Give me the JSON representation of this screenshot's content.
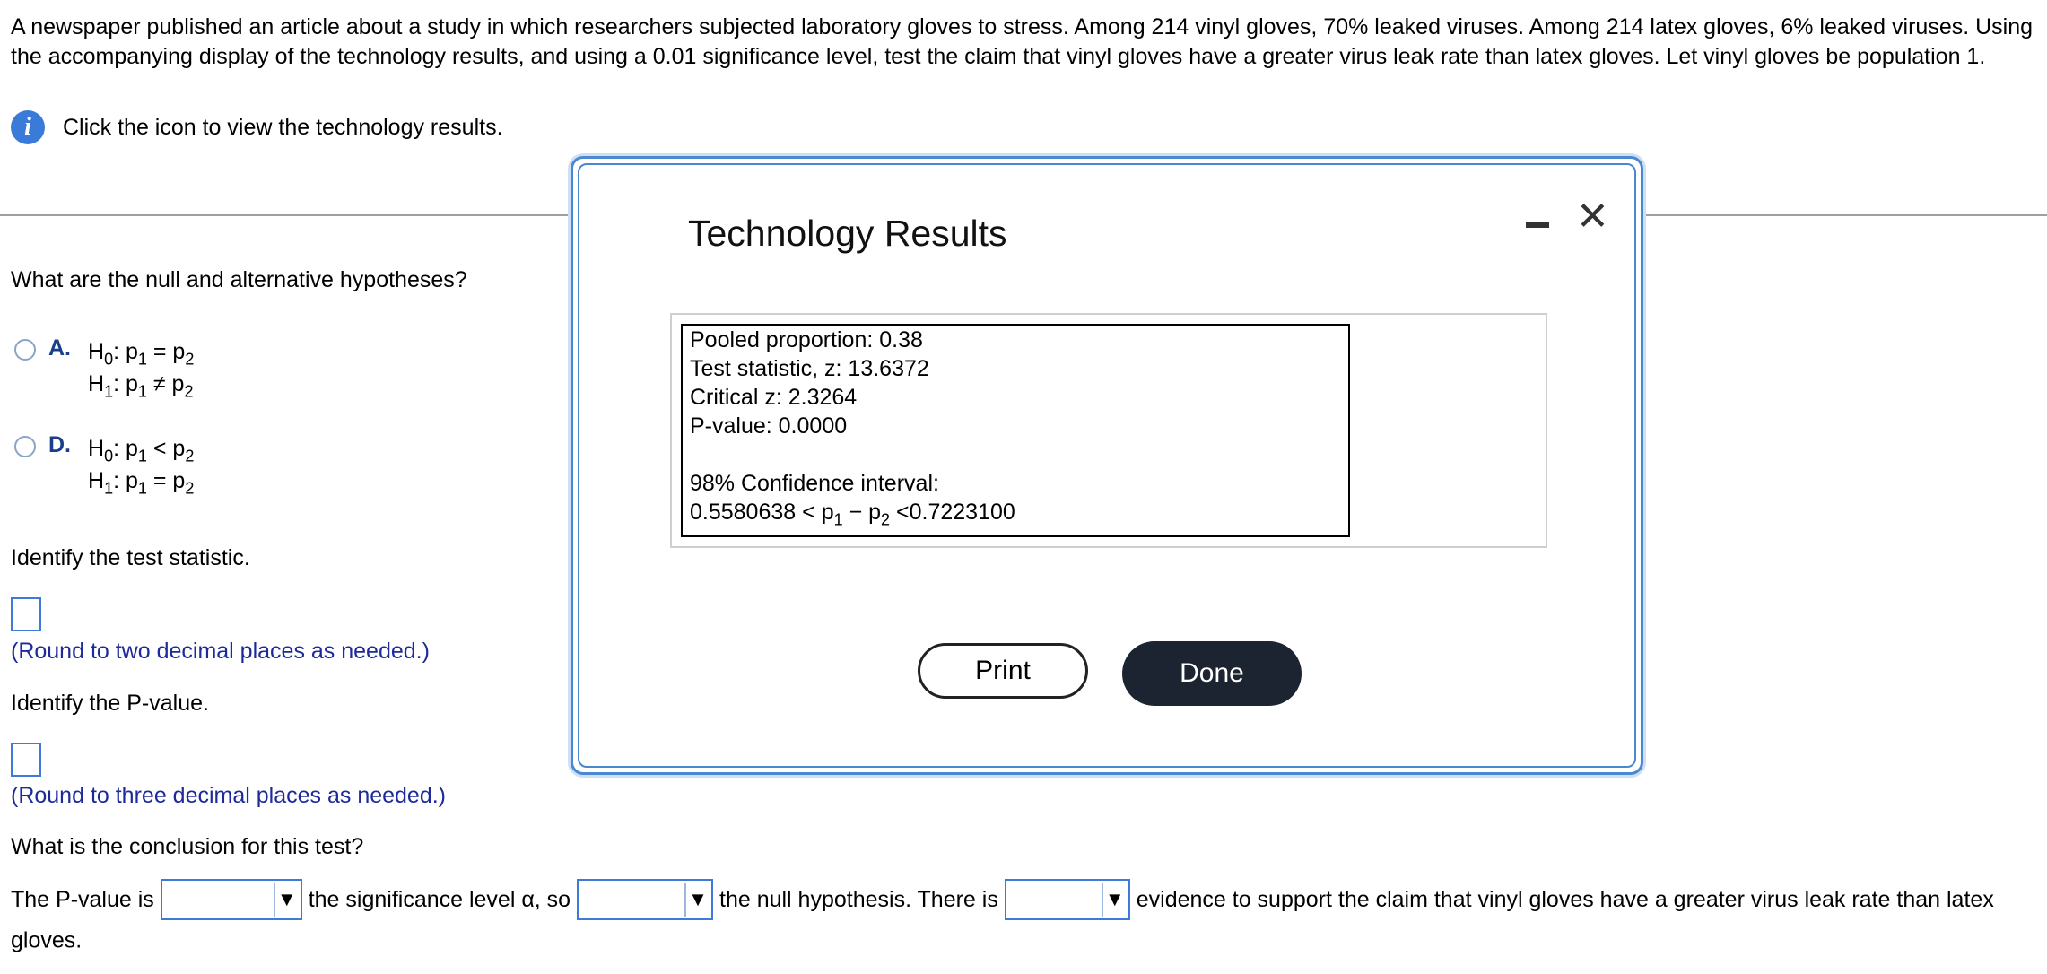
{
  "problem": {
    "text": "A newspaper published an article about a study in which researchers subjected laboratory gloves to stress. Among 214 vinyl gloves, 70% leaked viruses. Among 214 latex gloves, 6% leaked viruses. Using the accompanying display of the technology results, and using a 0.01 significance level, test the claim that vinyl gloves have a greater virus leak rate than latex gloves. Let vinyl gloves be population 1.",
    "info_icon_glyph": "i",
    "info_text": "Click the icon to view the technology results."
  },
  "hypotheses": {
    "question": "What are the null and alternative hypotheses?",
    "options": [
      {
        "letter": "A.",
        "h0": {
          "lhs": "H",
          "lsub": "0",
          "p1": "p",
          "p1sub": "1",
          "rel": "=",
          "p2": "p",
          "p2sub": "2"
        },
        "h1": {
          "lhs": "H",
          "lsub": "1",
          "p1": "p",
          "p1sub": "1",
          "rel": "≠",
          "p2": "p",
          "p2sub": "2"
        }
      },
      {
        "letter": "D.",
        "h0": {
          "lhs": "H",
          "lsub": "0",
          "p1": "p",
          "p1sub": "1",
          "rel": "<",
          "p2": "p",
          "p2sub": "2"
        },
        "h1": {
          "lhs": "H",
          "lsub": "1",
          "p1": "p",
          "p1sub": "1",
          "rel": "=",
          "p2": "p",
          "p2sub": "2"
        }
      }
    ]
  },
  "test_statistic": {
    "question": "Identify the test statistic.",
    "value": "",
    "hint": "(Round to two decimal places as needed.)"
  },
  "p_value": {
    "question": "Identify the P-value.",
    "value": "",
    "hint": "(Round to three decimal places as needed.)"
  },
  "conclusion": {
    "question": "What is the conclusion for this test?",
    "part1": "The P-value is",
    "dropdown1": "",
    "part2": "the significance level α, so",
    "dropdown2": "",
    "part3": "the null hypothesis. There is",
    "dropdown3": "",
    "part4": "evidence to support the claim that vinyl gloves have a greater virus leak rate than latex gloves."
  },
  "modal": {
    "title": "Technology Results",
    "close_glyph": "✕",
    "results": {
      "pooled": "Pooled proportion: 0.38",
      "test_stat": "Test statistic, z: 13.6372",
      "critical": "Critical z: 2.3264",
      "pvalue": "P-value: 0.0000",
      "ci_label": "98% Confidence interval:",
      "ci_low": "0.5580638",
      "ci_lt1": "<",
      "ci_p1": "p",
      "ci_p1sub": "1",
      "ci_minus": "−",
      "ci_p2": "p",
      "ci_p2sub": "2",
      "ci_lt2": "<",
      "ci_high": "0.7223100"
    },
    "print_label": "Print",
    "done_label": "Done"
  },
  "colors": {
    "accent_blue": "#3d7bd6",
    "hint_blue": "#1c2a9a",
    "done_bg": "#1c2431"
  }
}
